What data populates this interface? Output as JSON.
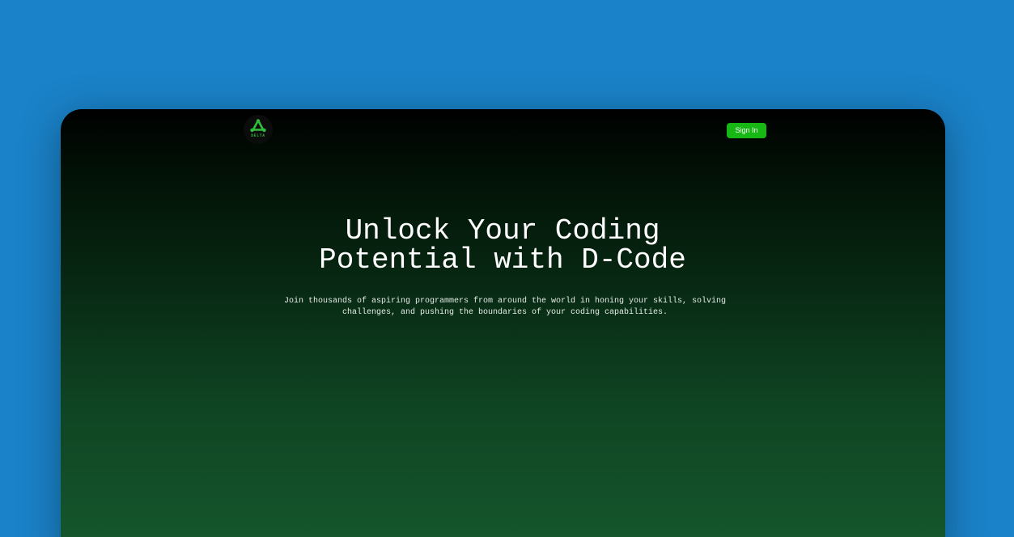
{
  "navbar": {
    "logo_text": "DELTA",
    "signin_label": "Sign In"
  },
  "hero": {
    "title_line1": "Unlock Your Coding",
    "title_line2": "Potential with D-Code",
    "subtitle": "Join thousands of aspiring programmers from around the world in honing your skills, solving challenges, and pushing the boundaries of your coding capabilities."
  },
  "colors": {
    "page_background": "#1a82c8",
    "window_gradient_top": "#000000",
    "window_gradient_bottom": "#16592e",
    "accent_green": "#17b814",
    "logo_green": "#2fbf3c",
    "text": "#ffffff"
  },
  "icons": {
    "logo": "delta-triangle-logo-icon"
  }
}
